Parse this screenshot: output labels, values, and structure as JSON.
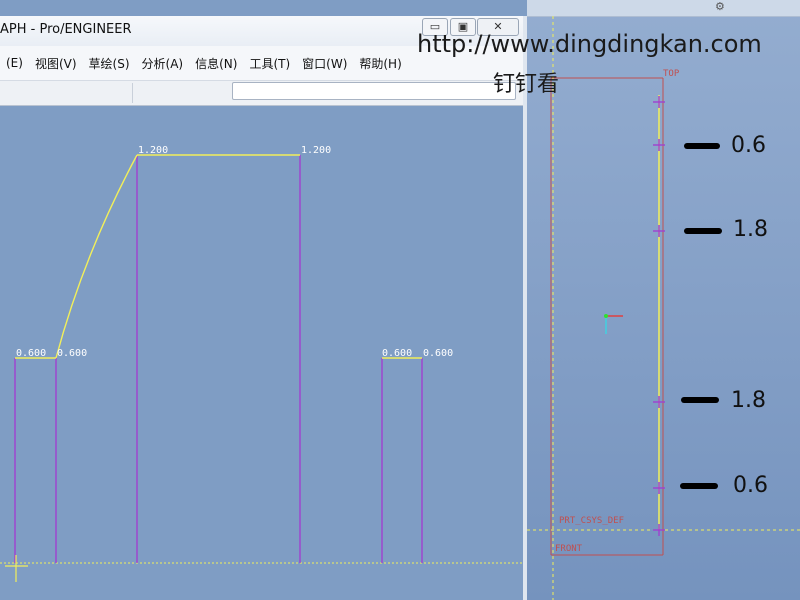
{
  "window": {
    "title": "APH - Pro/ENGINEER",
    "controls": {
      "minimize": "▭",
      "maximize": "▣",
      "close": "✕"
    }
  },
  "menu": [
    {
      "label": "(E)"
    },
    {
      "label": "视图(V)"
    },
    {
      "label": "草绘(S)"
    },
    {
      "label": "分析(A)"
    },
    {
      "label": "信息(N)"
    },
    {
      "label": "工具(T)"
    },
    {
      "label": "窗口(W)"
    },
    {
      "label": "帮助(H)"
    }
  ],
  "toolbar": {
    "field_value": ""
  },
  "graph": {
    "line_color": "#f2ef5a",
    "member_color": "#a040d0",
    "labels": {
      "left_start": "0.600",
      "left_end": "0.600",
      "mid_start": "1.200",
      "mid_end": "1.200",
      "right_start": "0.600",
      "right_end": "0.600"
    }
  },
  "watermark": {
    "url": "http://www.dingdingkan.com",
    "name": "钉钉看"
  },
  "model_view": {
    "top_label": "TOP",
    "csys_label": "PRT_CSYS_DEF",
    "bottom_label": "FRONT",
    "point_color": "#a040d0",
    "frame_color": "#c05050"
  },
  "callouts": [
    {
      "value": "0.6"
    },
    {
      "value": "1.8"
    },
    {
      "value": "1.8"
    },
    {
      "value": "0.6"
    }
  ]
}
